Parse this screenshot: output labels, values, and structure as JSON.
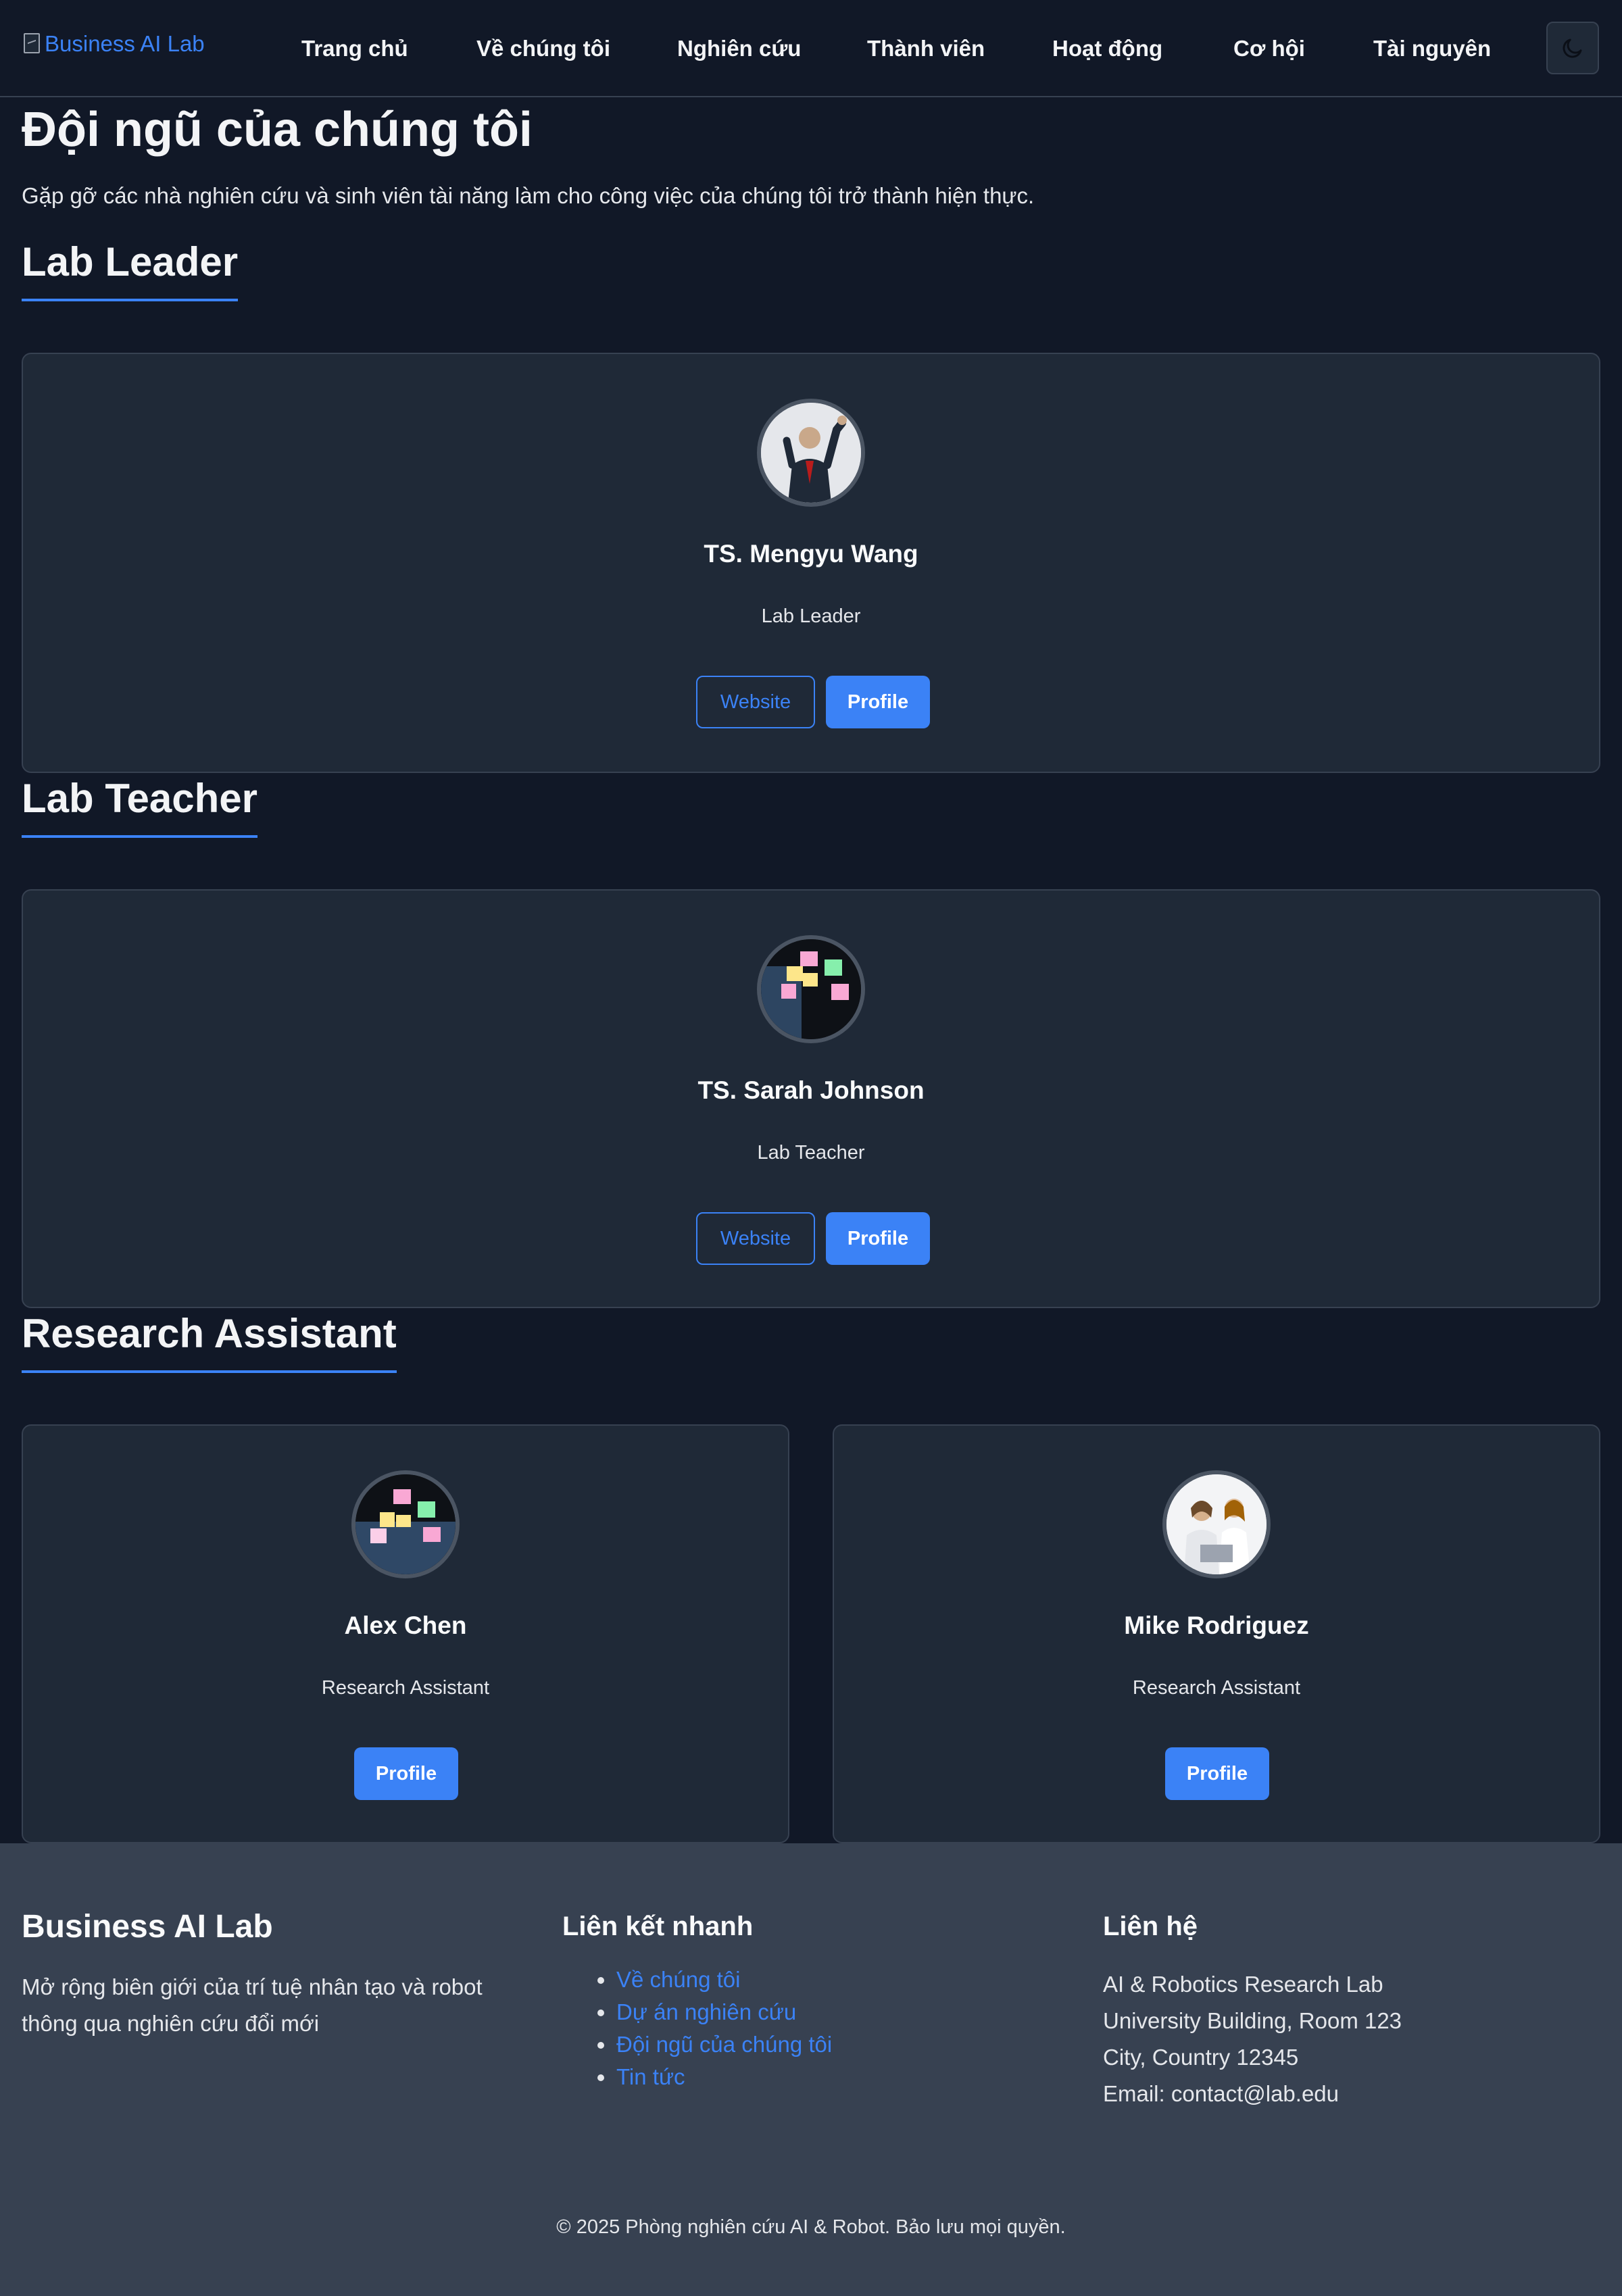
{
  "header": {
    "logo_alt": "Business AI Lab",
    "nav": [
      {
        "label": "Trang chủ"
      },
      {
        "label": "Về chúng tôi"
      },
      {
        "label": "Nghiên cứu"
      },
      {
        "label": "Thành viên"
      },
      {
        "label": "Hoạt động"
      },
      {
        "label": "Cơ hội"
      },
      {
        "label": "Tài nguyên"
      }
    ],
    "theme_toggle_icon": "moon-icon"
  },
  "page": {
    "title": "Đội ngũ của chúng tôi",
    "subtitle": "Gặp gỡ các nhà nghiên cứu và sinh viên tài năng làm cho công việc của chúng tôi trở thành hiện thực."
  },
  "sections": {
    "leader": {
      "title": "Lab Leader",
      "member": {
        "name": "TS. Mengyu Wang",
        "role": "Lab Leader",
        "website_label": "Website",
        "profile_label": "Profile"
      }
    },
    "teacher": {
      "title": "Lab Teacher",
      "member": {
        "name": "TS. Sarah Johnson",
        "role": "Lab Teacher",
        "website_label": "Website",
        "profile_label": "Profile"
      }
    },
    "assistants": {
      "title": "Research Assistant",
      "members": [
        {
          "name": "Alex Chen",
          "role": "Research Assistant",
          "profile_label": "Profile"
        },
        {
          "name": "Mike Rodriguez",
          "role": "Research Assistant",
          "profile_label": "Profile"
        }
      ]
    }
  },
  "footer": {
    "brand": "Business AI Lab",
    "description": "Mở rộng biên giới của trí tuệ nhân tạo và robot thông qua nghiên cứu đổi mới",
    "quick_links_title": "Liên kết nhanh",
    "quick_links": [
      "Về chúng tôi",
      "Dự án nghiên cứu",
      "Đội ngũ của chúng tôi",
      "Tin tức"
    ],
    "contact_title": "Liên hệ",
    "contact_lines": [
      "AI & Robotics Research Lab",
      "University Building, Room 123",
      "City, Country 12345",
      "Email: contact@lab.edu"
    ],
    "copyright": "© 2025 Phòng nghiên cứu AI & Robot. Bảo lưu mọi quyền."
  },
  "colors": {
    "background": "#111827",
    "card": "#1f2937",
    "border": "#374151",
    "accent": "#3b82f6",
    "footer": "#374151"
  }
}
